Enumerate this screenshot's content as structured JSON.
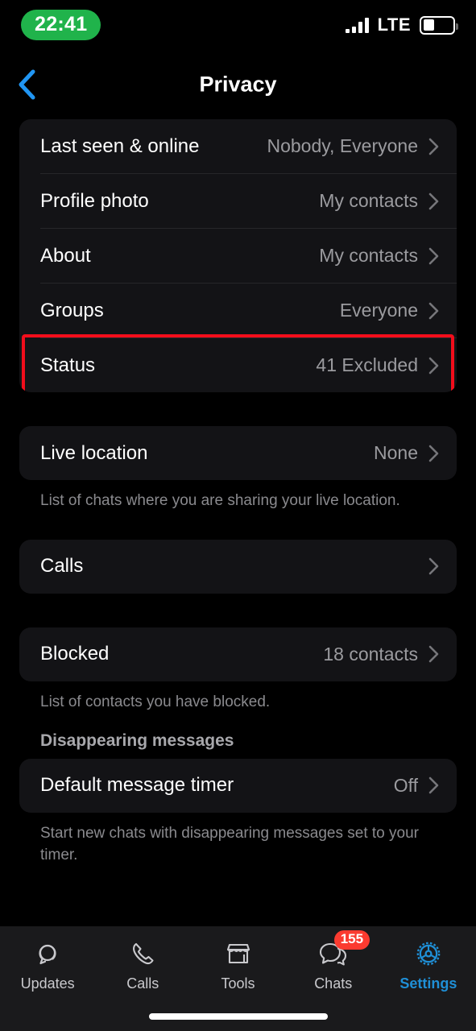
{
  "statusbar": {
    "time": "22:41",
    "network_label": "LTE",
    "signal_icon": "signal-bars-icon",
    "battery_icon": "battery-icon"
  },
  "navbar": {
    "title": "Privacy",
    "back_icon": "chevron-left-icon"
  },
  "colors": {
    "accent_blue": "#1f8fd6",
    "highlight_red": "#f20d1b",
    "badge_red": "#fb3b30",
    "time_pill_green": "#20b34b",
    "card_bg": "#131316",
    "page_bg": "#000000"
  },
  "groups": [
    {
      "name": "visibility-group",
      "rows": [
        {
          "label": "Last seen & online",
          "value": "Nobody, Everyone"
        },
        {
          "label": "Profile photo",
          "value": "My contacts"
        },
        {
          "label": "About",
          "value": "My contacts"
        },
        {
          "label": "Groups",
          "value": "Everyone"
        },
        {
          "label": "Status",
          "value": "41 Excluded",
          "highlighted": true
        }
      ]
    },
    {
      "name": "live-location-group",
      "rows": [
        {
          "label": "Live location",
          "value": "None"
        }
      ],
      "note": "List of chats where you are sharing your live location."
    },
    {
      "name": "calls-group",
      "rows": [
        {
          "label": "Calls",
          "value": ""
        }
      ]
    },
    {
      "name": "blocked-group",
      "rows": [
        {
          "label": "Blocked",
          "value": "18 contacts"
        }
      ],
      "note": "List of contacts you have blocked."
    },
    {
      "name": "disappearing-messages-group",
      "heading": "Disappearing messages",
      "rows": [
        {
          "label": "Default message timer",
          "value": "Off"
        }
      ],
      "note": "Start new chats with disappearing messages set to your timer."
    }
  ],
  "tabbar": {
    "items": [
      {
        "label": "Updates",
        "icon": "updates-icon",
        "active": false,
        "badge": ""
      },
      {
        "label": "Calls",
        "icon": "phone-icon",
        "active": false,
        "badge": ""
      },
      {
        "label": "Tools",
        "icon": "storefront-icon",
        "active": false,
        "badge": ""
      },
      {
        "label": "Chats",
        "icon": "chat-bubbles-icon",
        "active": false,
        "badge": "155"
      },
      {
        "label": "Settings",
        "icon": "gear-icon",
        "active": true,
        "badge": ""
      }
    ]
  }
}
